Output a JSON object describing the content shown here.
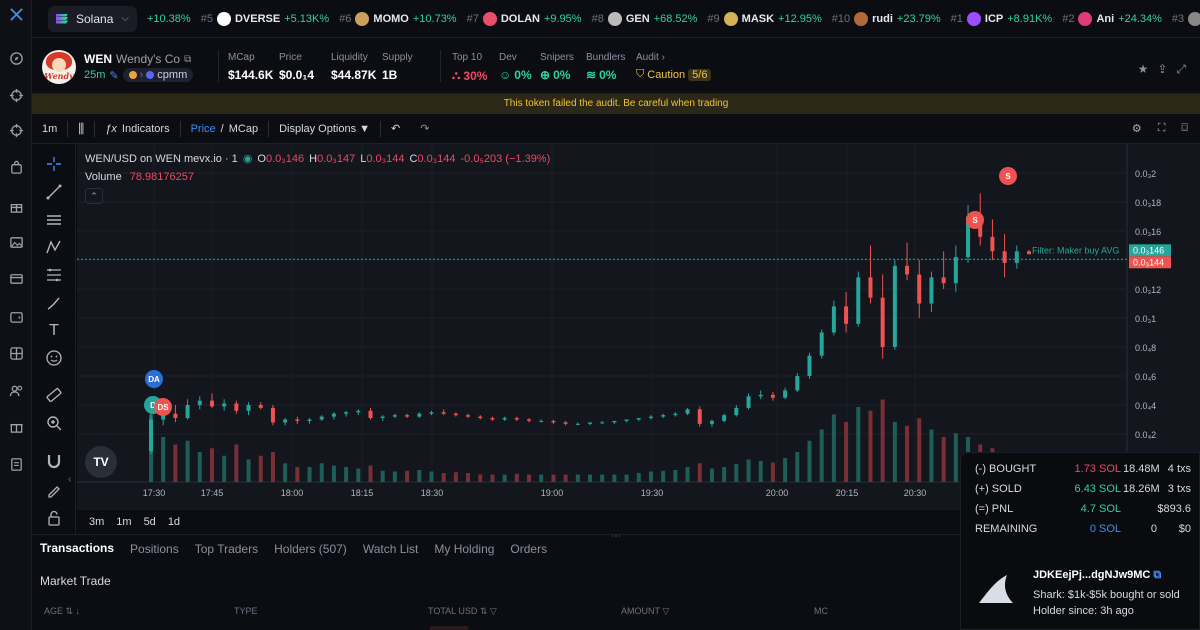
{
  "ticker": {
    "chain": "Solana",
    "first_change": "+10.38%",
    "items": [
      {
        "rank": "#5",
        "symbol": "DVERSE",
        "change": "+5.13K%",
        "color": "#ffffff"
      },
      {
        "rank": "#6",
        "symbol": "MOMO",
        "change": "+10.73%",
        "color": "#c9a15a"
      },
      {
        "rank": "#7",
        "symbol": "DOLAN",
        "change": "+9.95%",
        "color": "#e94f6d"
      },
      {
        "rank": "#8",
        "symbol": "GEN",
        "change": "+68.52%",
        "color": "#bbbbbb"
      },
      {
        "rank": "#9",
        "symbol": "MASK",
        "change": "+12.95%",
        "color": "#d4b05a"
      },
      {
        "rank": "#10",
        "symbol": "rudi",
        "change": "+23.79%",
        "color": "#b06a3a"
      },
      {
        "rank": "#1",
        "symbol": "ICP",
        "change": "+8.91K%",
        "color": "#9b4dff"
      },
      {
        "rank": "#2",
        "symbol": "Ani",
        "change": "+24.34%",
        "color": "#e23b7a"
      },
      {
        "rank": "#3",
        "symbol": "",
        "change": "",
        "color": "#888888"
      }
    ]
  },
  "token": {
    "logo_text": "Wendy",
    "symbol": "WEN",
    "name": "Wendy's Co",
    "age": "25m",
    "pool": "cpmm",
    "stats": [
      {
        "label": "MCap",
        "value": "$144.6K"
      },
      {
        "label": "Price",
        "value": "$0.0₁4"
      },
      {
        "label": "Liquidity",
        "value": "$44.87K"
      },
      {
        "label": "Supply",
        "value": "1B"
      }
    ],
    "audit": [
      {
        "label": "Top 10",
        "value": "30%",
        "status": "red"
      },
      {
        "label": "Dev",
        "value": "0%",
        "status": "green"
      },
      {
        "label": "Snipers",
        "value": "0%",
        "status": "green"
      },
      {
        "label": "Bundlers",
        "value": "0%",
        "status": "green"
      },
      {
        "label": "Audit ›",
        "value": "Caution",
        "badge": "5/6",
        "status": "amber"
      }
    ]
  },
  "warning": "This token failed the audit. Be careful when trading",
  "toolbar": {
    "interval": "1m",
    "indicators": "Indicators",
    "price": "Price",
    "slash": "/",
    "mcap": "MCap",
    "display_options": "Display Options ▼"
  },
  "chart_legend": {
    "title": "WEN/USD on WEN mevx.io · 1",
    "o_label": "O",
    "o": "0.0₃146",
    "h_label": "H",
    "h": "0.0₃147",
    "l_label": "L",
    "l": "0.0₃144",
    "c_label": "C",
    "c": "0.0₃144",
    "change": "-0.0₅203 (−1.39%)",
    "volume_label": "Volume",
    "volume": "78.98176257",
    "filter_label": "Filter: Maker buy AVG",
    "tag_top": "0.0₃146",
    "tag_bottom": "0.0₃144"
  },
  "chart_data": {
    "type": "candlestick",
    "x_ticks": [
      "17:30",
      "17:45",
      "18:00",
      "18:15",
      "18:30",
      "19:00",
      "19:30",
      "20:00",
      "20:15",
      "20:30"
    ],
    "y_ticks": [
      "0.0₃2",
      "0.0₃18",
      "0.0₃16",
      "0.0₃14",
      "0.0₃12",
      "0.0₃1",
      "0.0₄8",
      "0.0₄6",
      "0.0₄4",
      "0.0₄2"
    ],
    "y_values": [
      0.0002,
      0.00018,
      0.00016,
      0.00014,
      0.00012,
      0.0001,
      8e-05,
      6e-05,
      4e-05,
      2e-05
    ],
    "up_color": "#26a69a",
    "down_color": "#ef5350",
    "candles": [
      [
        8e-06,
        3.5e-05,
        6e-06,
        3e-05
      ],
      [
        3e-05,
        3.8e-05,
        2.6e-05,
        3.4e-05
      ],
      [
        3.4e-05,
        4e-05,
        2.8e-05,
        3.1e-05
      ],
      [
        3.1e-05,
        4.4e-05,
        3e-05,
        4e-05
      ],
      [
        4e-05,
        4.6e-05,
        3.7e-05,
        4.3e-05
      ],
      [
        4.3e-05,
        4.8e-05,
        3.8e-05,
        3.9e-05
      ],
      [
        3.9e-05,
        4.4e-05,
        3.6e-05,
        4.1e-05
      ],
      [
        4.1e-05,
        4.3e-05,
        3.4e-05,
        3.6e-05
      ],
      [
        3.6e-05,
        4.2e-05,
        3.3e-05,
        4e-05
      ],
      [
        4e-05,
        4.2e-05,
        3.7e-05,
        3.8e-05
      ],
      [
        3.8e-05,
        4e-05,
        2.6e-05,
        2.8e-05
      ],
      [
        2.8e-05,
        3.1e-05,
        2.6e-05,
        3e-05
      ],
      [
        3e-05,
        3.2e-05,
        2.7e-05,
        2.9e-05
      ],
      [
        2.9e-05,
        3.1e-05,
        2.7e-05,
        3e-05
      ],
      [
        3e-05,
        3.3e-05,
        2.9e-05,
        3.2e-05
      ],
      [
        3.2e-05,
        3.5e-05,
        3e-05,
        3.4e-05
      ],
      [
        3.4e-05,
        3.6e-05,
        3.2e-05,
        3.5e-05
      ],
      [
        3.5e-05,
        3.7e-05,
        3.3e-05,
        3.6e-05
      ],
      [
        3.6e-05,
        3.8e-05,
        3e-05,
        3.1e-05
      ],
      [
        3.1e-05,
        3.3e-05,
        2.9e-05,
        3.2e-05
      ],
      [
        3.2e-05,
        3.4e-05,
        3.1e-05,
        3.3e-05
      ],
      [
        3.3e-05,
        3.4e-05,
        3.1e-05,
        3.2e-05
      ],
      [
        3.2e-05,
        3.5e-05,
        3.1e-05,
        3.4e-05
      ],
      [
        3.4e-05,
        3.6e-05,
        3.3e-05,
        3.5e-05
      ],
      [
        3.5e-05,
        3.7e-05,
        3.3e-05,
        3.4e-05
      ],
      [
        3.4e-05,
        3.5e-05,
        3.2e-05,
        3.3e-05
      ],
      [
        3.3e-05,
        3.4e-05,
        3.1e-05,
        3.2e-05
      ],
      [
        3.2e-05,
        3.3e-05,
        3e-05,
        3.1e-05
      ],
      [
        3.1e-05,
        3.2e-05,
        2.9e-05,
        3e-05
      ],
      [
        3e-05,
        3.2e-05,
        2.9e-05,
        3.1e-05
      ],
      [
        3.1e-05,
        3.2e-05,
        2.9e-05,
        3e-05
      ],
      [
        3e-05,
        3.1e-05,
        2.8e-05,
        2.9e-05
      ],
      [
        2.9e-05,
        3e-05,
        2.8e-05,
        2.9e-05
      ],
      [
        2.9e-05,
        3e-05,
        2.7e-05,
        2.8e-05
      ],
      [
        2.8e-05,
        2.9e-05,
        2.6e-05,
        2.7e-05
      ],
      [
        2.7e-05,
        2.8e-05,
        2.6e-05,
        2.7e-05
      ],
      [
        2.7e-05,
        2.8e-05,
        2.6e-05,
        2.8e-05
      ],
      [
        2.8e-05,
        2.9e-05,
        2.7e-05,
        2.8e-05
      ],
      [
        2.8e-05,
        2.9e-05,
        2.7e-05,
        2.9e-05
      ],
      [
        2.9e-05,
        3e-05,
        2.8e-05,
        3e-05
      ],
      [
        3e-05,
        3.1e-05,
        2.9e-05,
        3.1e-05
      ],
      [
        3.1e-05,
        3.3e-05,
        3e-05,
        3.2e-05
      ],
      [
        3.2e-05,
        3.4e-05,
        3.1e-05,
        3.3e-05
      ],
      [
        3.3e-05,
        3.5e-05,
        3.2e-05,
        3.4e-05
      ],
      [
        3.4e-05,
        3.8e-05,
        3.3e-05,
        3.7e-05
      ],
      [
        3.7e-05,
        3.9e-05,
        2.5e-05,
        2.7e-05
      ],
      [
        2.7e-05,
        3e-05,
        2.5e-05,
        2.9e-05
      ],
      [
        2.9e-05,
        3.4e-05,
        2.8e-05,
        3.3e-05
      ],
      [
        3.3e-05,
        4e-05,
        3.2e-05,
        3.8e-05
      ],
      [
        3.8e-05,
        4.8e-05,
        3.7e-05,
        4.6e-05
      ],
      [
        4.6e-05,
        5e-05,
        4.4e-05,
        4.7e-05
      ],
      [
        4.7e-05,
        4.9e-05,
        4.3e-05,
        4.5e-05
      ],
      [
        4.5e-05,
        5.2e-05,
        4.4e-05,
        5e-05
      ],
      [
        5e-05,
        6.2e-05,
        4.9e-05,
        6e-05
      ],
      [
        6e-05,
        7.6e-05,
        5.8e-05,
        7.4e-05
      ],
      [
        7.4e-05,
        9.2e-05,
        7.2e-05,
        9e-05
      ],
      [
        9e-05,
        0.000112,
        8.8e-05,
        0.000108
      ],
      [
        0.000108,
        0.000118,
        9e-05,
        9.6e-05
      ],
      [
        9.6e-05,
        0.000132,
        9.4e-05,
        0.000128
      ],
      [
        0.000128,
        0.00015,
        0.00011,
        0.000114
      ],
      [
        0.000114,
        0.00013,
        7.2e-05,
        8e-05
      ],
      [
        8e-05,
        0.00014,
        7.8e-05,
        0.000136
      ],
      [
        0.000136,
        0.000152,
        0.000126,
        0.00013
      ],
      [
        0.00013,
        0.00014,
        0.0001,
        0.00011
      ],
      [
        0.00011,
        0.000132,
        0.000104,
        0.000128
      ],
      [
        0.000128,
        0.000146,
        0.00012,
        0.000124
      ],
      [
        0.000124,
        0.00015,
        0.000118,
        0.000142
      ],
      [
        0.000142,
        0.000178,
        0.000138,
        0.00017
      ],
      [
        0.00017,
        0.000186,
        0.00015,
        0.000156
      ],
      [
        0.000156,
        0.000168,
        0.00014,
        0.000146
      ],
      [
        0.000146,
        0.000158,
        0.000128,
        0.000138
      ],
      [
        0.000138,
        0.00015,
        0.000134,
        0.000146
      ],
      [
        0.000146,
        0.000147,
        0.000144,
        0.000144
      ]
    ],
    "volumes": [
      0.9,
      0.6,
      0.5,
      0.55,
      0.4,
      0.45,
      0.35,
      0.5,
      0.3,
      0.35,
      0.4,
      0.25,
      0.2,
      0.2,
      0.25,
      0.22,
      0.2,
      0.18,
      0.22,
      0.15,
      0.14,
      0.15,
      0.16,
      0.14,
      0.12,
      0.13,
      0.12,
      0.1,
      0.1,
      0.1,
      0.11,
      0.1,
      0.1,
      0.1,
      0.1,
      0.1,
      0.1,
      0.1,
      0.1,
      0.1,
      0.12,
      0.14,
      0.15,
      0.16,
      0.2,
      0.25,
      0.18,
      0.2,
      0.24,
      0.3,
      0.28,
      0.26,
      0.32,
      0.4,
      0.55,
      0.7,
      0.9,
      0.8,
      1.0,
      0.95,
      1.1,
      0.8,
      0.75,
      0.85,
      0.7,
      0.6,
      0.65,
      0.6,
      0.5,
      0.45,
      0.4,
      0.3
    ],
    "markers": [
      {
        "label": "DA",
        "color": "#2b6fd6",
        "candle": 0,
        "price": 5.8e-05
      },
      {
        "label": "D",
        "color": "#26a69a",
        "candle": 0,
        "price": 4.2e-05
      },
      {
        "label": "DS",
        "color": "#ef5350",
        "candle": 1,
        "price": 4.1e-05
      },
      {
        "label": "S",
        "color": "#ef5350",
        "candle": 59,
        "price": 0.00018
      },
      {
        "label": "S",
        "color": "#ef5350",
        "candle": 67,
        "price": 0.0002
      }
    ]
  },
  "intervals": [
    "3m",
    "1m",
    "5d",
    "1d"
  ],
  "bottom_tabs": [
    "Transactions",
    "Positions",
    "Top Traders",
    "Holders (507)",
    "Watch List",
    "My Holding",
    "Orders"
  ],
  "market_trade": "Market Trade",
  "columns": [
    "AGE ⇅ ↓",
    "TYPE",
    "TOTAL USD ⇅ ▽",
    "AMOUNT ▽",
    "MC"
  ],
  "tooltip": {
    "rows": [
      {
        "label": "(-) BOUGHT",
        "sol": "1.73 SOL",
        "amount": "18.48M",
        "txs": "4 txs",
        "color": "red"
      },
      {
        "label": "(+) SOLD",
        "sol": "6.43 SOL",
        "amount": "18.26M",
        "txs": "3 txs",
        "color": "green"
      },
      {
        "label": "(=) PNL",
        "sol": "4.7 SOL",
        "amount": "",
        "txs": "$893.6",
        "color": "green"
      },
      {
        "label": "REMAINING",
        "sol": "0 SOL",
        "amount": "0",
        "txs": "$0",
        "color": "blue"
      }
    ],
    "address": "JDKEejPj...dgNJw9MC",
    "shark": "Shark: $1k-$5k bought or sold",
    "since": "Holder since: 3h ago"
  }
}
